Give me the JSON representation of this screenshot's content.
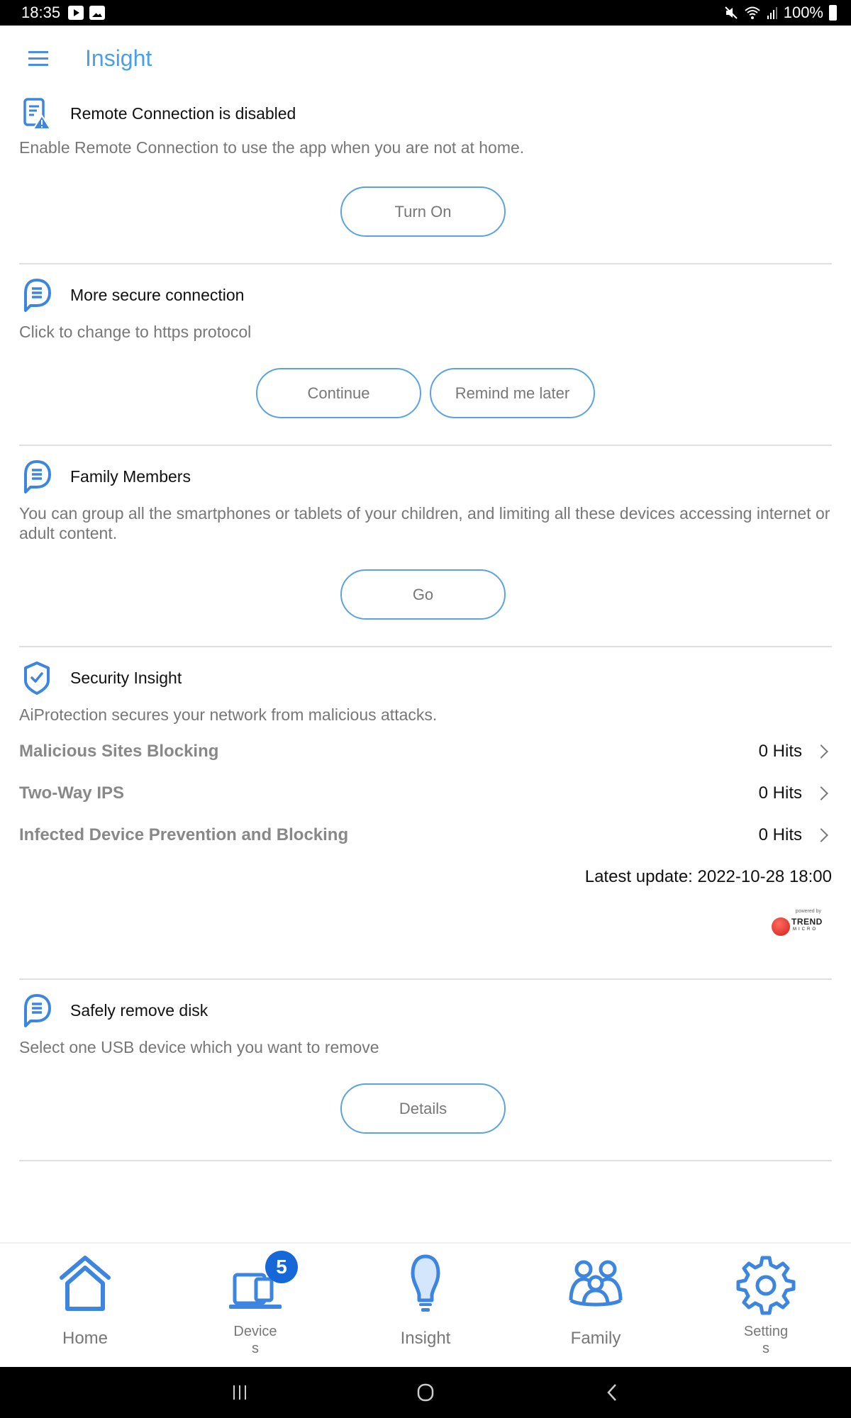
{
  "status_bar": {
    "time": "18:35",
    "icons_left": [
      "youtube-icon",
      "image-icon"
    ],
    "icons_right": [
      "mute-icon",
      "wifi-icon",
      "signal-icon"
    ],
    "battery": "100%"
  },
  "appbar": {
    "title": "Insight",
    "menu_icon": "hamburger-menu-icon"
  },
  "colors": {
    "accent": "#4a9fe8",
    "button_border": "#5aa3e0",
    "badge": "#1668d8",
    "divider": "#e0e0e0"
  },
  "cards": {
    "remote": {
      "icon": "document-warning-icon",
      "title": "Remote Connection is disabled",
      "description": "Enable Remote Connection to use the app when you are not at home.",
      "button": "Turn On"
    },
    "secure": {
      "icon": "chat-bubble-icon",
      "title": "More secure connection",
      "description": "Click to change to https protocol",
      "button_primary": "Continue",
      "button_secondary": "Remind me later"
    },
    "family": {
      "icon": "chat-bubble-icon",
      "title": "Family Members",
      "description": "You can group all the smartphones or tablets of your children, and limiting all these devices accessing internet or adult content.",
      "button": "Go"
    },
    "security": {
      "icon": "shield-check-icon",
      "title": "Security Insight",
      "description": "AiProtection secures your network from malicious attacks.",
      "rows": [
        {
          "label": "Malicious Sites Blocking",
          "value": "0 Hits"
        },
        {
          "label": "Two-Way IPS",
          "value": "0 Hits"
        },
        {
          "label": "Infected Device Prevention and Blocking",
          "value": "0 Hits"
        }
      ],
      "latest_update": "Latest update: 2022-10-28 18:00",
      "powered_by": "powered by",
      "brand_name": "TREND",
      "brand_sub": "MICRO"
    },
    "disk": {
      "icon": "chat-bubble-icon",
      "title": "Safely remove disk",
      "description": "Select one USB device which you want to remove",
      "button": "Details"
    }
  },
  "bottom_nav": {
    "items": [
      {
        "label": "Home",
        "icon": "home-icon"
      },
      {
        "label": "Device\ns",
        "icon": "devices-icon",
        "badge": "5"
      },
      {
        "label": "Insight",
        "icon": "lightbulb-icon",
        "active": true
      },
      {
        "label": "Family",
        "icon": "family-icon"
      },
      {
        "label": "Setting\ns",
        "icon": "gear-icon"
      }
    ]
  },
  "system_nav": [
    "recent-apps-icon",
    "home-circle-icon",
    "back-icon"
  ]
}
